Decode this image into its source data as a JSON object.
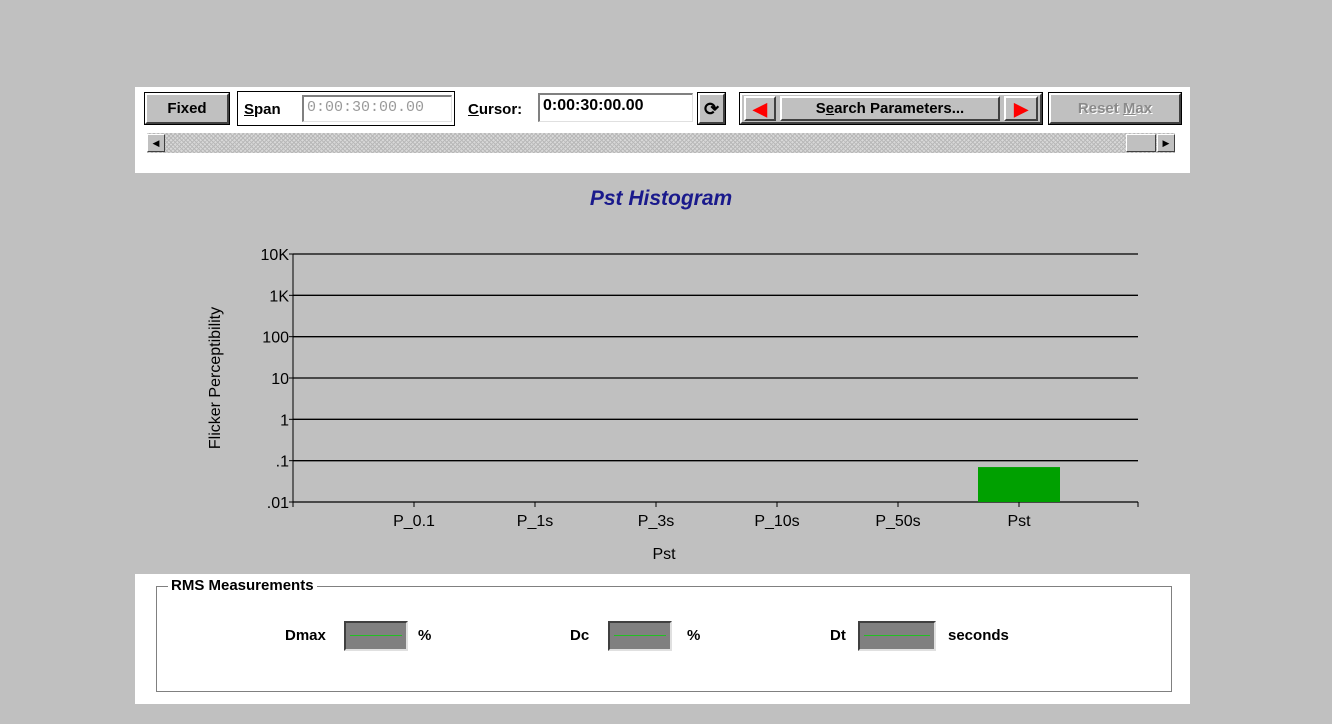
{
  "toolbar": {
    "fixed_label": "Fixed",
    "span_label_pre": "S",
    "span_label_post": "pan",
    "span_value": "0:00:30:00.00",
    "cursor_label_pre": "C",
    "cursor_label_post": "ursor:",
    "cursor_value": "0:00:30:00.00",
    "refresh_icon": "refresh-icon",
    "prev_icon": "left-arrow-icon",
    "search_label_pre": "S",
    "search_label_mid": "e",
    "search_label_post": "arch Parameters...",
    "next_icon": "right-arrow-icon",
    "reset_label_pre": "Reset ",
    "reset_label_mid": "M",
    "reset_label_post": "ax"
  },
  "chart_data": {
    "type": "bar",
    "title": "Pst Histogram",
    "xlabel": "Pst",
    "ylabel": "Flicker Perceptibility",
    "yscale": "log",
    "ylim": [
      0.01,
      10000
    ],
    "yticks": [
      {
        "value": 10000,
        "label": "10K"
      },
      {
        "value": 1000,
        "label": "1K"
      },
      {
        "value": 100,
        "label": "100"
      },
      {
        "value": 10,
        "label": "10"
      },
      {
        "value": 1,
        "label": "1"
      },
      {
        "value": 0.1,
        "label": ".1"
      },
      {
        "value": 0.01,
        "label": ".01"
      }
    ],
    "categories": [
      "P_0.1",
      "P_1s",
      "P_3s",
      "P_10s",
      "P_50s",
      "Pst"
    ],
    "values": [
      null,
      null,
      null,
      null,
      null,
      0.07
    ],
    "bar_color": "#00a000",
    "grid": true,
    "title_color": "#1a1a8c"
  },
  "rms": {
    "title": "RMS Measurements",
    "items": [
      {
        "label": "Dmax",
        "unit": "%"
      },
      {
        "label": "Dc",
        "unit": "%"
      },
      {
        "label": "Dt",
        "unit": "seconds"
      }
    ]
  }
}
